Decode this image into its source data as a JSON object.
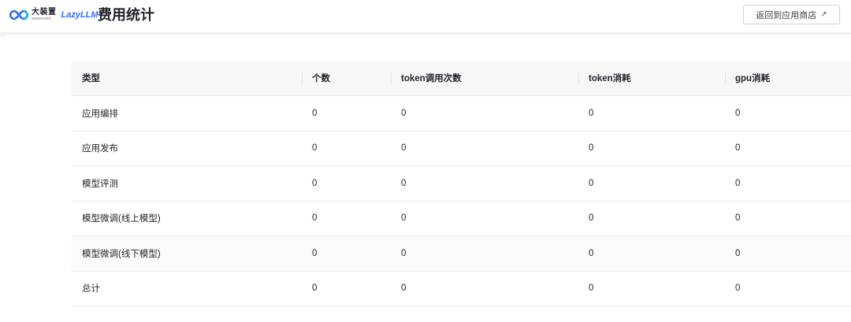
{
  "header": {
    "brand_cn": "大装置",
    "brand_en": "sensecore",
    "brand_product": "LazyLLM",
    "page_title": "费用统计",
    "back_button_label": "返回到应用商店",
    "back_button_icon": "arrow-up-right-icon"
  },
  "table": {
    "columns": [
      "类型",
      "个数",
      "token调用次数",
      "token消耗",
      "gpu消耗"
    ],
    "rows": [
      [
        "应用编排",
        "0",
        "0",
        "0",
        "0"
      ],
      [
        "应用发布",
        "0",
        "0",
        "0",
        "0"
      ],
      [
        "模型评测",
        "0",
        "0",
        "0",
        "0"
      ],
      [
        "模型微调(线上模型)",
        "0",
        "0",
        "0",
        "0"
      ],
      [
        "模型微调(线下模型)",
        "0",
        "0",
        "0",
        "0"
      ],
      [
        "总计",
        "0",
        "0",
        "0",
        "0"
      ]
    ]
  },
  "colors": {
    "accent": "#2f6cf6",
    "header_bg": "#f7f7f8",
    "row_alt_bg": "#fafafa"
  }
}
